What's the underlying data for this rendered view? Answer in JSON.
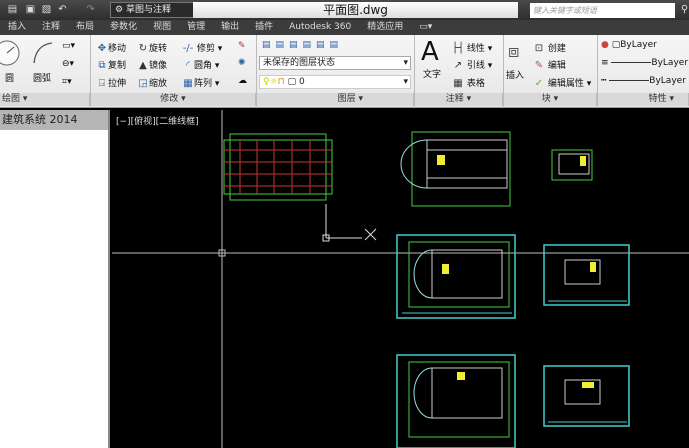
{
  "titlebar": {
    "workspace": "草图与注释",
    "document_title": "平面图.dwg",
    "search_placeholder": "键入关键字或短语"
  },
  "tabs": [
    "插入",
    "注释",
    "布局",
    "参数化",
    "视图",
    "管理",
    "输出",
    "插件",
    "Autodesk 360",
    "精选应用"
  ],
  "draw_panel": {
    "label": "绘图 ▾",
    "circle": "圆",
    "arc": "圆弧"
  },
  "modify_panel": {
    "label": "修改 ▾",
    "move": "移动",
    "rotate": "旋转",
    "trim": "修剪",
    "copy": "复制",
    "mirror": "镜像",
    "fillet": "圆角",
    "stretch": "拉伸",
    "scale": "缩放",
    "array": "阵列"
  },
  "layers_panel": {
    "label": "图层 ▾",
    "layer_state": "未保存的图层状态",
    "current_layer": "0"
  },
  "annotation_panel": {
    "label": "注释 ▾",
    "text": "文字",
    "linear": "线性",
    "leader": "引线",
    "table": "表格"
  },
  "block_panel": {
    "label": "块 ▾",
    "insert": "插入",
    "create": "创建",
    "edit": "编辑",
    "edit_attributes": "编辑属性"
  },
  "properties_panel": {
    "label": "特性 ▾",
    "color": "ByLayer",
    "linetype": "ByLayer",
    "lineweight": "ByLayer"
  },
  "left_panel": {
    "title": "建筑系统 2014"
  },
  "viewport": {
    "label": "[−][俯视][二维线框]"
  }
}
